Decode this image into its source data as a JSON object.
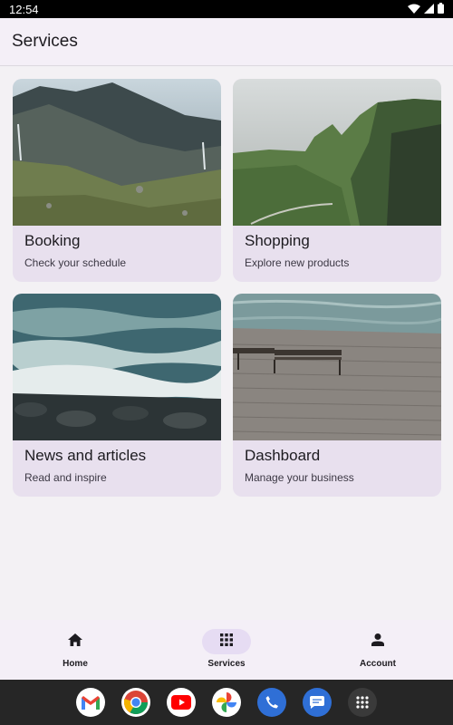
{
  "status_bar": {
    "time": "12:54"
  },
  "app_bar": {
    "title": "Services"
  },
  "cards": [
    {
      "title": "Booking",
      "subtitle": "Check your schedule"
    },
    {
      "title": "Shopping",
      "subtitle": "Explore new products"
    },
    {
      "title": "News and articles",
      "subtitle": "Read and inspire"
    },
    {
      "title": "Dashboard",
      "subtitle": "Manage your business"
    }
  ],
  "bottom_nav": {
    "items": [
      {
        "label": "Home",
        "icon": "home-icon"
      },
      {
        "label": "Services",
        "icon": "apps-grid-icon",
        "active": true
      },
      {
        "label": "Account",
        "icon": "person-icon"
      }
    ]
  },
  "taskbar": {
    "apps": [
      "gmail-icon",
      "chrome-icon",
      "youtube-icon",
      "photos-icon",
      "phone-icon",
      "messages-icon",
      "app-drawer-icon"
    ]
  },
  "colors": {
    "surface": "#f4eff7",
    "card": "#e8e0ee",
    "active_indicator": "#e6dcf3",
    "text": "#1d1b20"
  }
}
